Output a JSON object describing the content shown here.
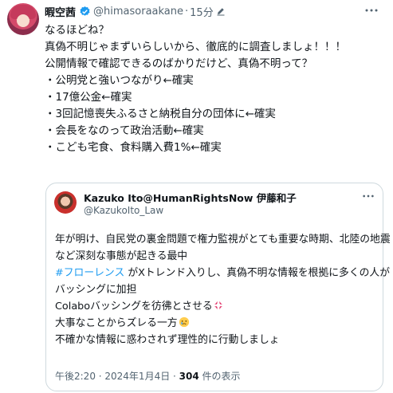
{
  "tweet": {
    "author_name": "暇空茜",
    "author_handle": "@himasoraakane",
    "separator": "·",
    "time": "15分",
    "lines": [
      "なるほどね？",
      "真偽不明じゃまずいらしいから、徹底的に調査しましょ！！！",
      "公開情報で確認できるのばかりだけど、真偽不明って？",
      "・公明党と強いつながり←確実",
      "・17億公金←確実",
      "・3回記憶喪失ふるさと納税自分の団体に←確実",
      "・会長をなのって政治活動←確実",
      "・こども宅食、食料購入費1%←確実"
    ]
  },
  "quote": {
    "author_name": "Kazuko Ito@HumanRightsNow 伊藤和子",
    "author_handle": "@KazukoIto_Law",
    "line1": "年が明け、自民党の裏金問題で権力監視がとても重要な時期、北陸の地震",
    "line2": "など深刻な事態が起きる最中",
    "hashtag": "#フローレンス",
    "line3_rest": " がXトレンド入りし、真偽不明な情報を根拠に多くの人が",
    "line4": "バッシングに加担",
    "line5": "Colaboバッシングを彷彿とさせる",
    "line6": "大事なことからズレる一方",
    "line7": "不確かな情報に惑わされず理性的に行動しましょ",
    "meta_time": "午後2:20 · 2024年1月4日 · ",
    "views_count": "304",
    "views_label": " 件の表示"
  },
  "icons": [
    "verified-badge-icon",
    "edit-pencil-icon",
    "more-icon",
    "anger-emoji-icon",
    "sad-emoji-icon"
  ],
  "colors": {
    "verified": "#1d9bf0",
    "hashtag": "#1d9bf0",
    "secondary_text": "#536471",
    "border": "#cfd9de"
  }
}
